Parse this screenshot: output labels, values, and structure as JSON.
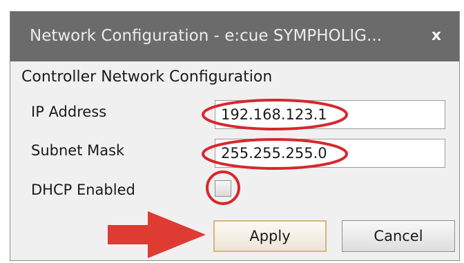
{
  "window": {
    "title": "Network Configuration - e:cue SYMPHOLIG...",
    "close_glyph": "x"
  },
  "section": {
    "title": "Controller Network Configuration"
  },
  "fields": {
    "ip_label": "IP Address",
    "ip_value": "192.168.123.1",
    "mask_label": "Subnet Mask",
    "mask_value": "255.255.255.0",
    "dhcp_label": "DHCP Enabled",
    "dhcp_checked": false
  },
  "buttons": {
    "apply_label": "Apply",
    "cancel_label": "Cancel"
  },
  "annotation_colors": {
    "highlight": "#d6282e",
    "arrow": "#de3b33"
  }
}
